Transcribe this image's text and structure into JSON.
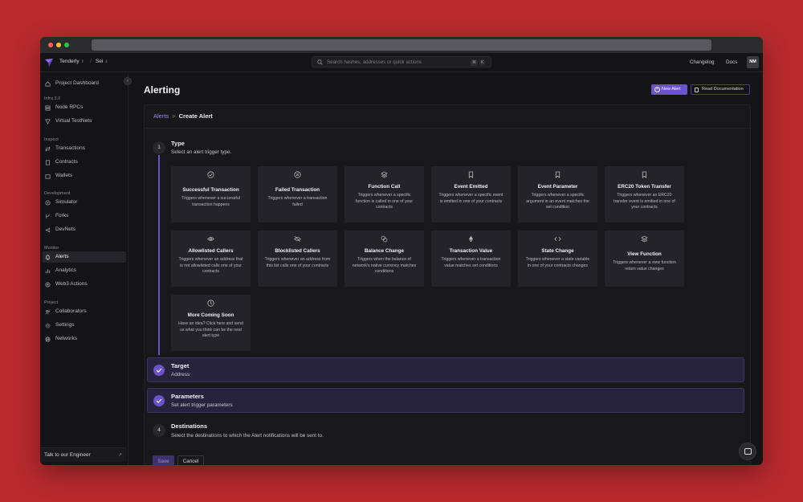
{
  "topbar": {
    "org": "Tenderly",
    "project": "Sei",
    "search_placeholder": "Search hashes, addresses or quick actions",
    "kbd1": "⌘",
    "kbd2": "K",
    "changelog": "Changelog",
    "docs": "Docs",
    "avatar": "NM"
  },
  "sidebar": {
    "project_dashboard": "Project Dashboard",
    "sections": {
      "infra": "Infra 3.0",
      "inspect": "Inspect",
      "development": "Development",
      "monitor": "Monitor",
      "project": "Project"
    },
    "items": {
      "node_rpcs": "Node RPCs",
      "virtual_testnets": "Virtual TestNets",
      "transactions": "Transactions",
      "contracts": "Contracts",
      "wallets": "Wallets",
      "simulator": "Simulator",
      "forks": "Forks",
      "devnets": "DevNets",
      "alerts": "Alerts",
      "analytics": "Analytics",
      "web3_actions": "Web3 Actions",
      "collaborators": "Collaborators",
      "settings": "Settings",
      "networks": "Networks"
    },
    "talk": "Talk to our Engineer"
  },
  "header": {
    "title": "Alerting",
    "new_alert": "New Alert",
    "read_docs": "Read Documentation"
  },
  "breadcrumb": {
    "alerts": "Alerts",
    "separator": ">",
    "current": "Create Alert"
  },
  "steps": {
    "type": {
      "num": "1",
      "title": "Type",
      "sub": "Select an alert trigger type."
    },
    "target": {
      "title": "Target",
      "sub": "Address"
    },
    "parameters": {
      "title": "Parameters",
      "sub": "Set alert trigger parameters"
    },
    "destinations": {
      "num": "4",
      "title": "Destinations",
      "sub": "Select the destinations to which the Alert notifications will be sent to."
    }
  },
  "tiles": [
    {
      "icon": "check-circle-icon",
      "title": "Successful Transaction",
      "desc": "Triggers whenever a successful transaction happens"
    },
    {
      "icon": "x-circle-icon",
      "title": "Failed Transaction",
      "desc": "Triggers whenever a transaction failed"
    },
    {
      "icon": "layers-icon",
      "title": "Function Call",
      "desc": "Triggers whenever a specific function is called in one of your contracts"
    },
    {
      "icon": "bookmark-icon",
      "title": "Event Emitted",
      "desc": "Triggers whenever a specific event is emitted in one of your contracts"
    },
    {
      "icon": "bookmark-icon",
      "title": "Event Parameter",
      "desc": "Triggers whenever a specific argument in an event matches the set condition"
    },
    {
      "icon": "bookmark-icon",
      "title": "ERC20 Token Transfer",
      "desc": "Triggers whenever an ERC20 transfer event is emitted in one of your contracts"
    },
    {
      "icon": "eye-icon",
      "title": "Allowlisted Callers",
      "desc": "Triggers whenever an address that is not allowlisted calls one of your contracts"
    },
    {
      "icon": "eye-off-icon",
      "title": "Blocklisted Callers",
      "desc": "Triggers whenever an address from this list calls one of your contracts"
    },
    {
      "icon": "coins-icon",
      "title": "Balance Change",
      "desc": "Triggers when the balance of network's native currency matches conditions"
    },
    {
      "icon": "ethereum-icon",
      "title": "Transaction Value",
      "desc": "Triggers whenever a transaction value matches set conditions"
    },
    {
      "icon": "code-icon",
      "title": "State Change",
      "desc": "Triggers whenever a state variable in one of your contracts changes"
    },
    {
      "icon": "layers-icon",
      "title": "View Function",
      "desc": "Triggers whenever a view function return value changes"
    },
    {
      "icon": "clock-icon",
      "title": "More Coming Soon",
      "desc": "Have an idea? Click here and send us what you think can be the next alert type"
    }
  ],
  "actions": {
    "save": "Save",
    "cancel": "Cancel"
  },
  "colors": {
    "accent": "#6b53c9",
    "background": "#141416",
    "outer": "#b82a2e"
  }
}
